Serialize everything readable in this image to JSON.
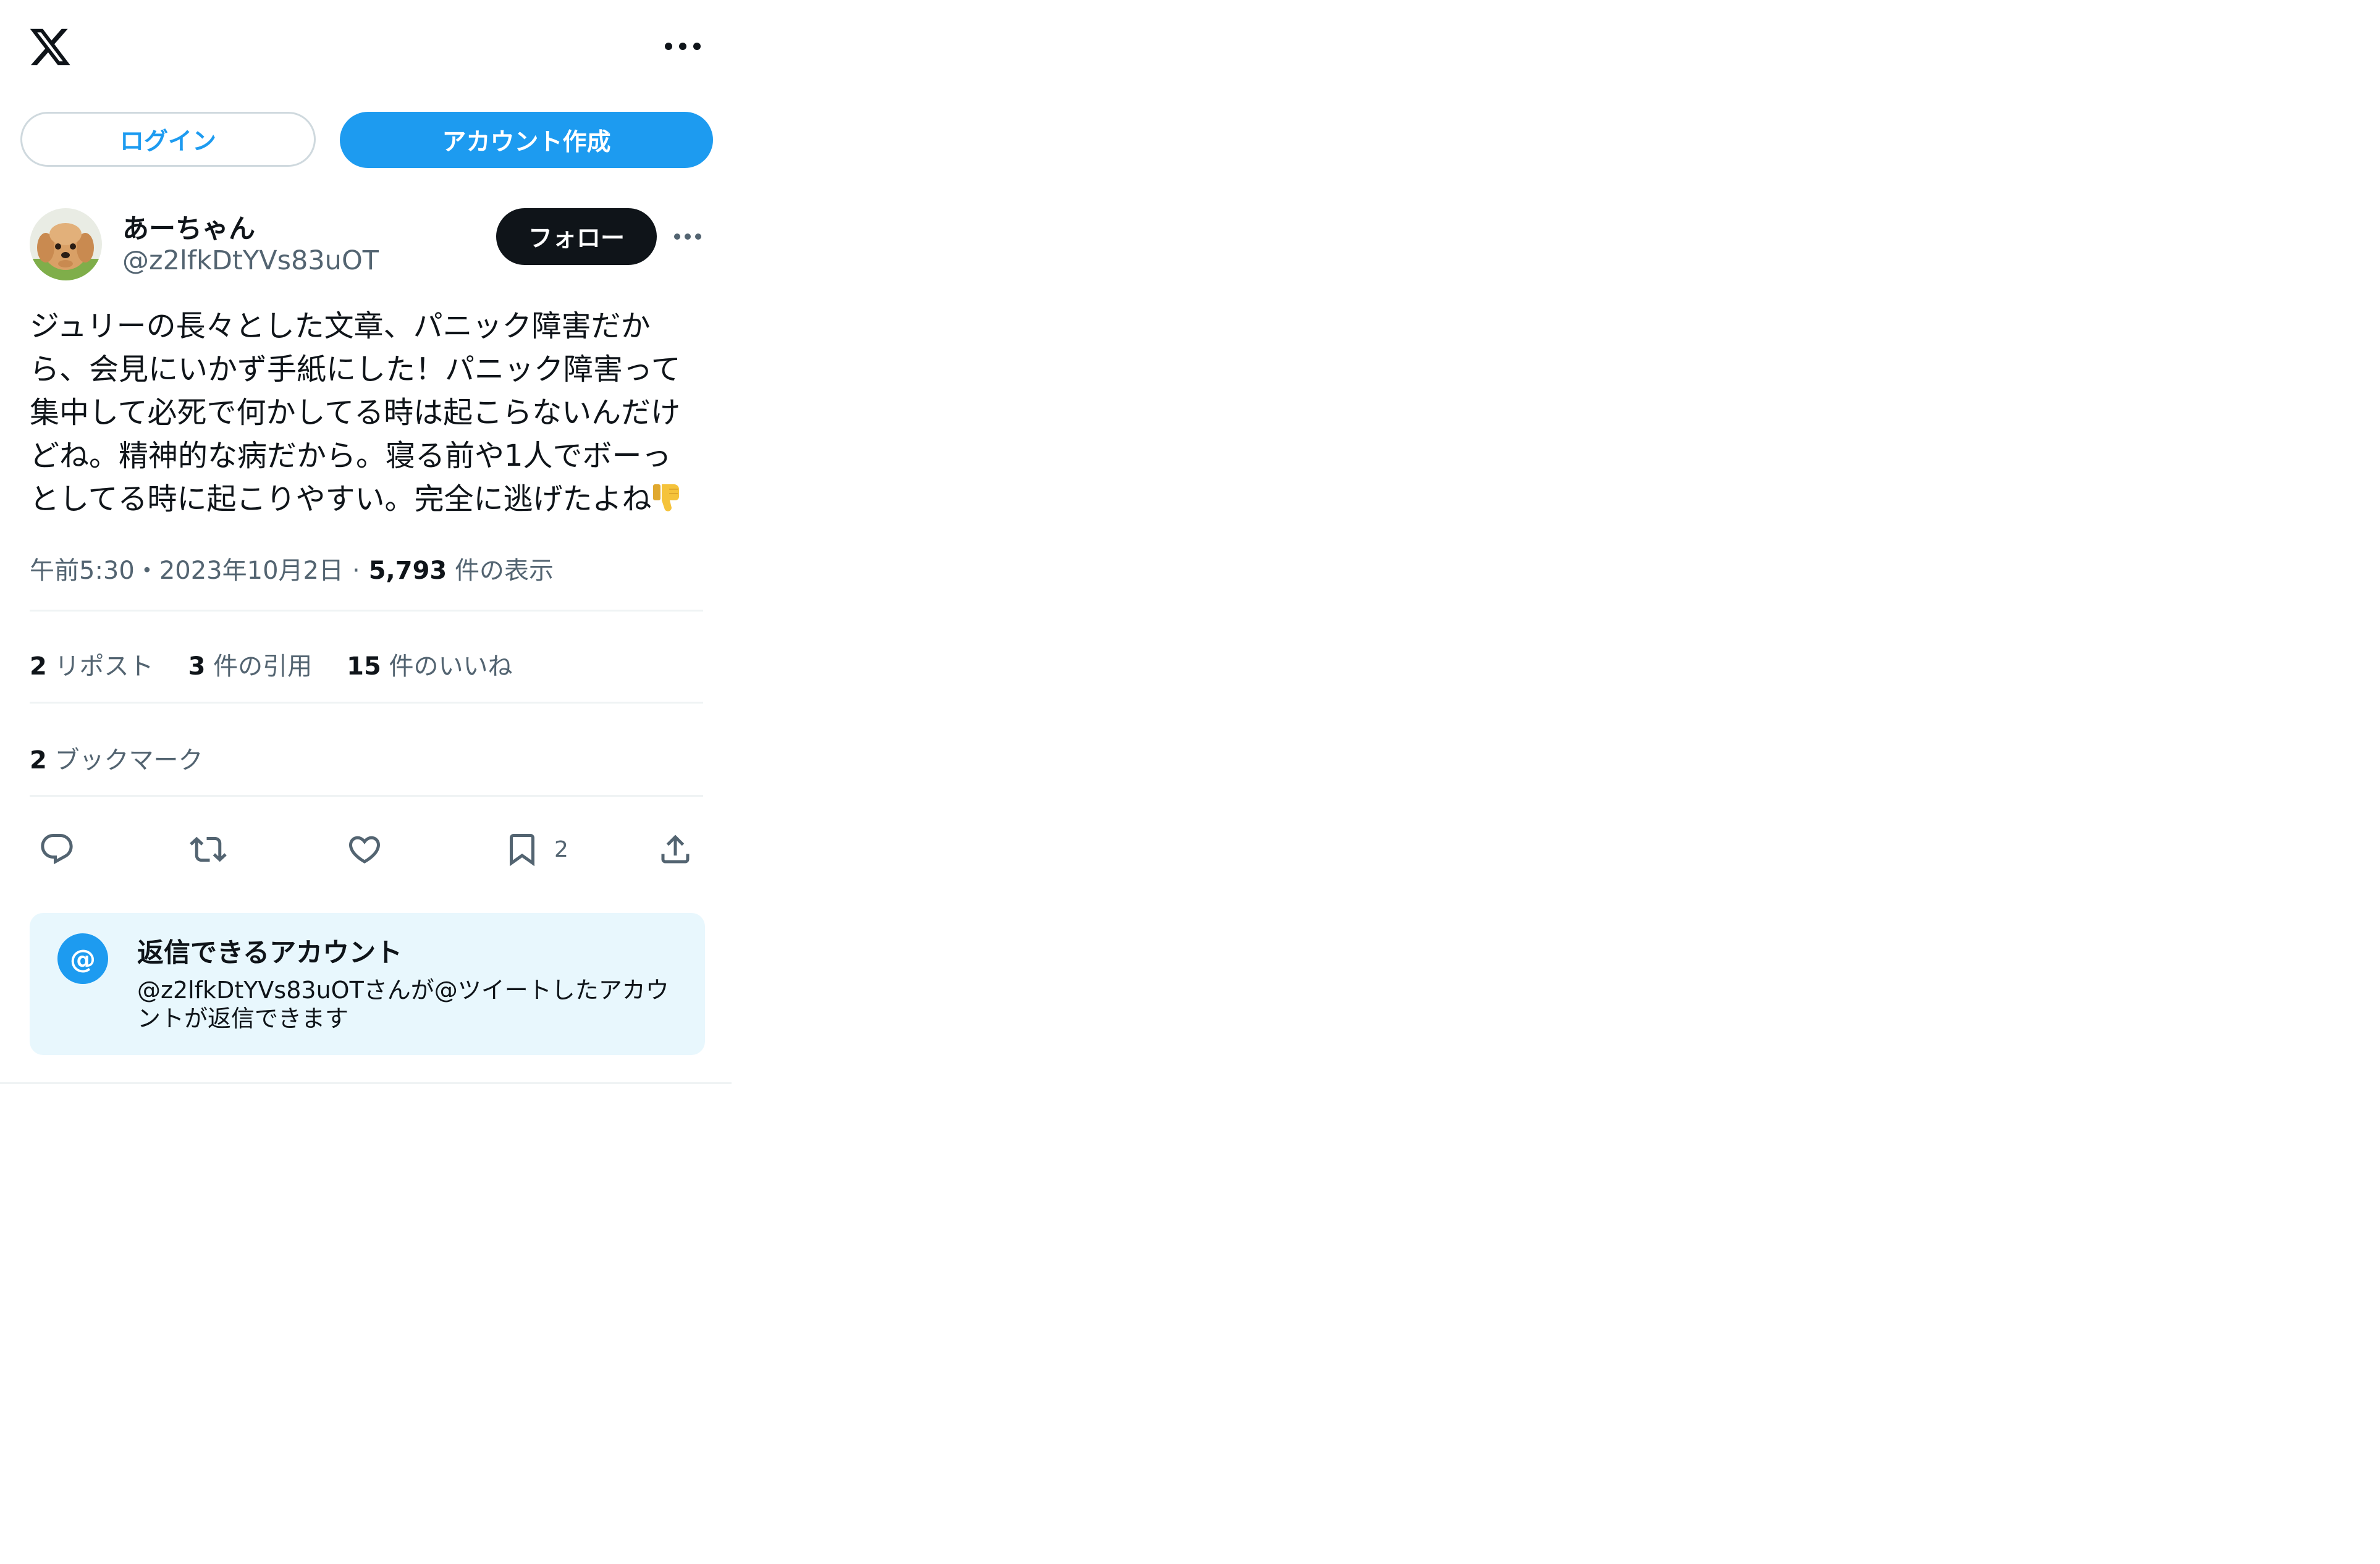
{
  "header": {
    "logo_icon": "x-logo-icon",
    "more_icon": "more-horizontal-icon"
  },
  "auth": {
    "login_label": "ログイン",
    "signup_label": "アカウント作成"
  },
  "tweet": {
    "display_name": "あーちゃん",
    "handle": "@z2lfkDtYVs83uOT",
    "follow_label": "フォロー",
    "text": "ジュリーの長々とした文章、パニック障害だか\nら、会見にいかず手紙にした！パニック障害って\n集中して必死で何かしてる時は起こらないんだけ\nどね。精神的な病だから。寝る前や1人でボーっ\nとしてる時に起こりやすい。完全に逃げたよね",
    "emoji_icon": "thumbs-down-icon",
    "time": "午前5:30",
    "separator": "・",
    "date": "2023年10月2日",
    "dot": "·",
    "views_count": "5,793",
    "views_label": "件の表示"
  },
  "stats": {
    "reposts_count": "2",
    "reposts_label": "リポスト",
    "quotes_count": "3",
    "quotes_label": "件の引用",
    "likes_count": "15",
    "likes_label": "件のいいね",
    "bookmarks_count": "2",
    "bookmarks_label": "ブックマーク"
  },
  "actions": {
    "reply_icon": "reply-icon",
    "repost_icon": "repost-icon",
    "like_icon": "heart-icon",
    "bookmark_icon": "bookmark-icon",
    "bookmark_count": "2",
    "share_icon": "share-icon"
  },
  "reply_restriction": {
    "badge": "@",
    "title": "返信できるアカウント",
    "description": "@z2lfkDtYVs83uOTさんが@ツイートしたアカウントが返信できます"
  },
  "colors": {
    "accent": "#1d9bf0",
    "text_primary": "#0f1419",
    "text_secondary": "#536471",
    "divider": "#eff3f4",
    "reply_box_bg": "#e8f7fd"
  }
}
